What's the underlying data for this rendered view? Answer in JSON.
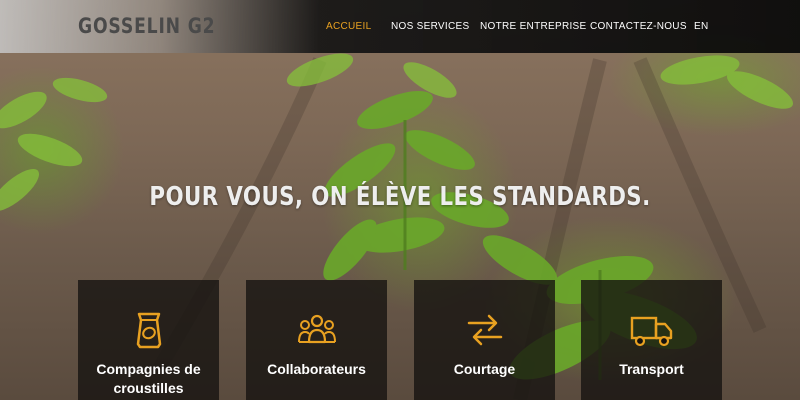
{
  "header": {
    "logo_text": "GOSSELIN G2",
    "nav": [
      {
        "label": "ACCUEIL",
        "active": true
      },
      {
        "label": "NOS SERVICES",
        "active": false
      },
      {
        "label": "NOTRE ENTREPRISE",
        "active": false
      },
      {
        "label": "CONTACTEZ-NOUS",
        "active": false
      },
      {
        "label": "EN",
        "active": false
      }
    ]
  },
  "hero": {
    "tagline": "POUR VOUS, ON ÉLÈVE LES STANDARDS."
  },
  "services": [
    {
      "label": "Compagnies de croustilles",
      "icon": "chip-bag-icon"
    },
    {
      "label": "Collaborateurs",
      "icon": "people-icon"
    },
    {
      "label": "Courtage",
      "icon": "exchange-arrows-icon"
    },
    {
      "label": "Transport",
      "icon": "truck-icon"
    }
  ],
  "colors": {
    "accent": "#e8a121",
    "card_bg": "#14120f",
    "header_bg": "#0a0a0a"
  }
}
